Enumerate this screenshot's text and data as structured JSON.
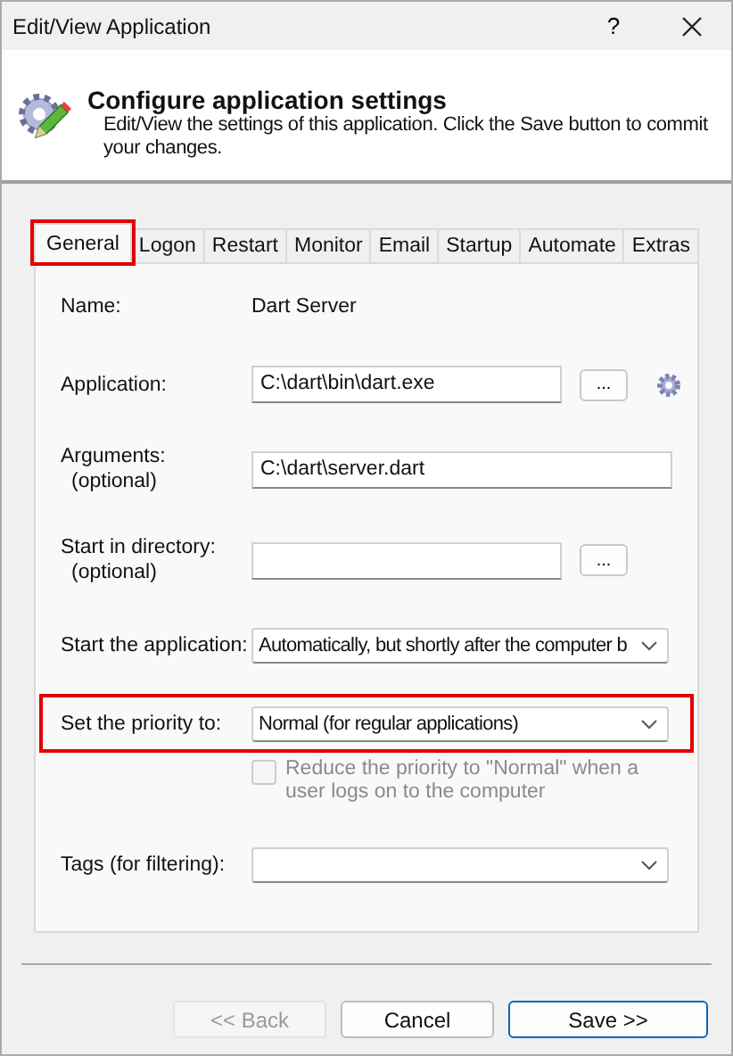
{
  "window": {
    "title": "Edit/View Application",
    "help": "?"
  },
  "header": {
    "title": "Configure application settings",
    "description": "Edit/View the settings of this application. Click the Save button to commit your changes."
  },
  "tabs": [
    {
      "label": "General",
      "selected": true,
      "highlighted": true
    },
    {
      "label": "Logon",
      "selected": false,
      "highlighted": false
    },
    {
      "label": "Restart",
      "selected": false,
      "highlighted": false
    },
    {
      "label": "Monitor",
      "selected": false,
      "highlighted": false
    },
    {
      "label": "Email",
      "selected": false,
      "highlighted": false
    },
    {
      "label": "Startup",
      "selected": false,
      "highlighted": false
    },
    {
      "label": "Automate",
      "selected": false,
      "highlighted": false
    },
    {
      "label": "Extras",
      "selected": false,
      "highlighted": false
    }
  ],
  "rows": [
    {
      "kind": "static",
      "label": "Name:",
      "value": "Dart Server",
      "highlighted": false
    },
    {
      "kind": "input",
      "label": "Application:",
      "value": "C:\\dart\\bin\\dart.exe",
      "browse": "...",
      "settings_icon": true,
      "highlighted": false
    },
    {
      "kind": "input",
      "label": "Arguments:",
      "sublabel": "(optional)",
      "value": "C:\\dart\\server.dart",
      "highlighted": false
    },
    {
      "kind": "input",
      "label": "Start in directory:",
      "sublabel": "(optional)",
      "browse": "...",
      "highlighted": false
    },
    {
      "kind": "dropdown",
      "label": "Start the application:",
      "value": "Automatically, but shortly after the computer b",
      "highlighted": false
    },
    {
      "kind": "dropdown",
      "label": "Set the priority to:",
      "value": "Normal (for regular applications)",
      "highlighted": true
    },
    {
      "kind": "checkbox",
      "label": "Reduce the priority to \"Normal\" when a user logs on to the computer",
      "checked": false,
      "disabled": true,
      "highlighted": false
    },
    {
      "kind": "dropdown",
      "label": "Tags (for filtering):",
      "highlighted": false
    }
  ],
  "buttons": [
    {
      "label": "<< Back",
      "disabled": true,
      "primary": false
    },
    {
      "label": "Cancel",
      "disabled": false,
      "primary": false
    },
    {
      "label": "Save >>",
      "disabled": false,
      "primary": true
    }
  ]
}
